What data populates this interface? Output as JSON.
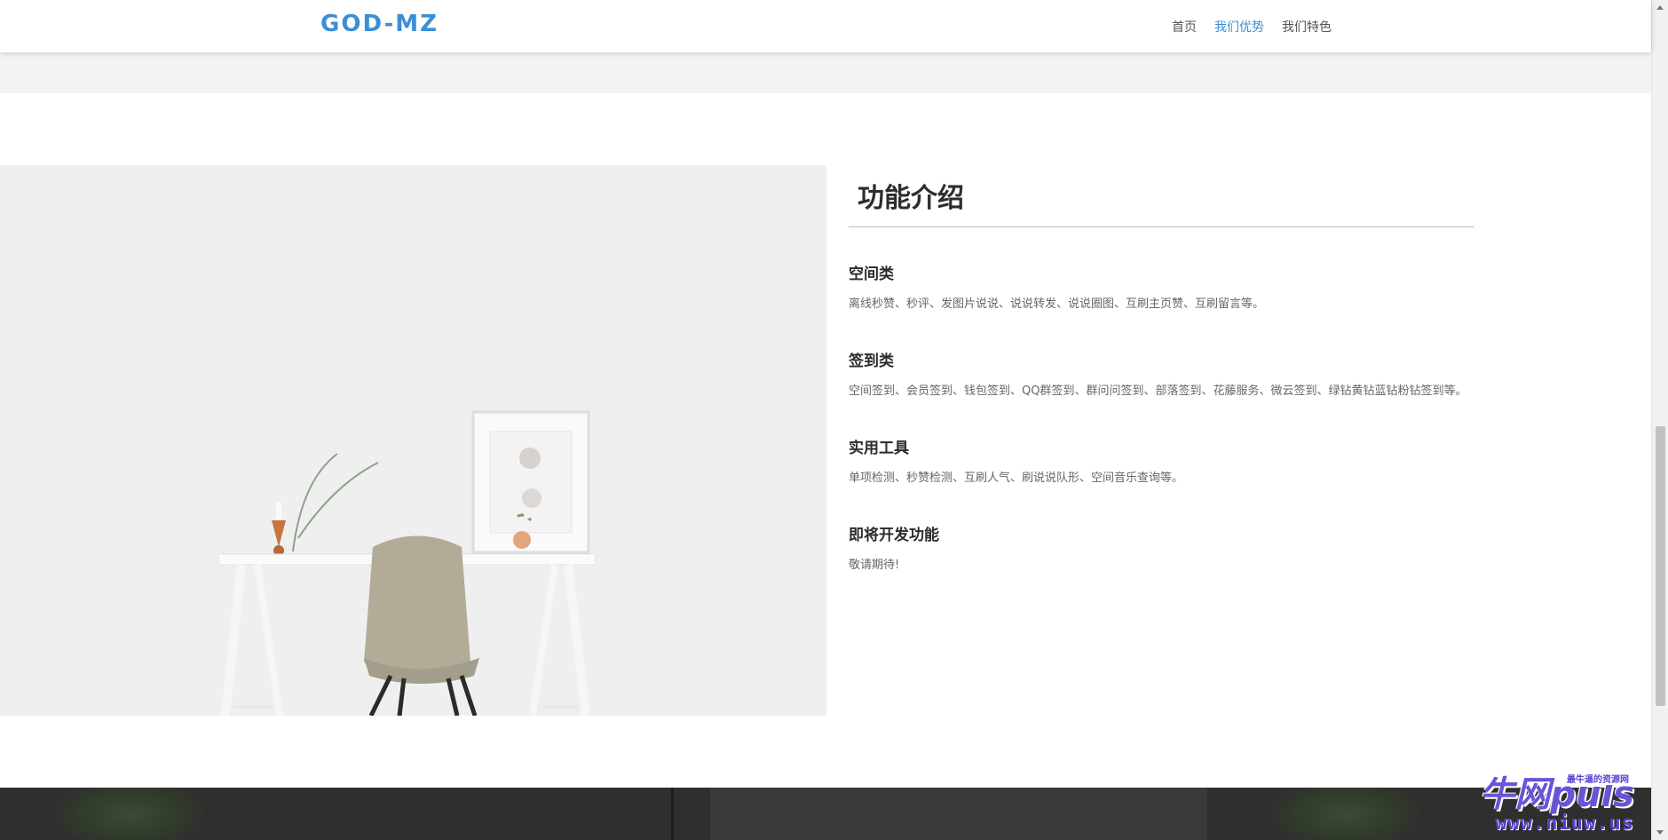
{
  "header": {
    "brand": "GOD-MZ",
    "nav": [
      {
        "label": "首页",
        "active": false
      },
      {
        "label": "我们优势",
        "active": true
      },
      {
        "label": "我们特色",
        "active": false
      }
    ]
  },
  "features": {
    "title": "功能介绍",
    "items": [
      {
        "heading": "空间类",
        "text": "离线秒赞、秒评、发图片说说、说说转发、说说圈图、互刷主页赞、互刷留言等。"
      },
      {
        "heading": "签到类",
        "text": "空间签到、会员签到、钱包签到、QQ群签到、群问问签到、部落签到、花藤服务、微云签到、绿钻黄钻蓝钻粉钻签到等。"
      },
      {
        "heading": "实用工具",
        "text": "单项检测、秒赞检测、互刷人气、刷说说队形、空间音乐查询等。"
      },
      {
        "heading": "即将开发功能",
        "text": "敬请期待!"
      }
    ]
  },
  "watermark": {
    "logo_text": "牛网puls",
    "tagline": "最牛逼的资源网",
    "url": "www.niuw.us"
  },
  "colors": {
    "accent": "#3b8fd6",
    "watermark": "#6b53d6"
  }
}
